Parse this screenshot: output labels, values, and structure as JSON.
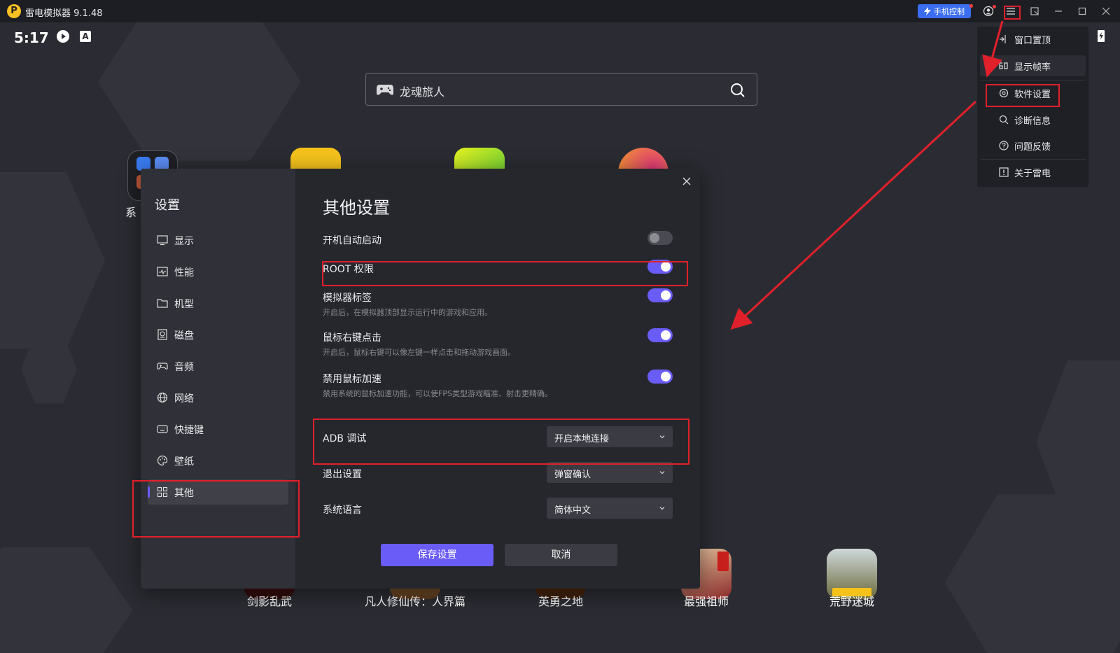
{
  "app": {
    "logo_letter": "P",
    "title": "雷电模拟器 9.1.48"
  },
  "titlebar": {
    "phone_control": "手机控制"
  },
  "status": {
    "time": "5:17",
    "ime": "A"
  },
  "search": {
    "placeholder": "龙魂旅人"
  },
  "desktop_icons": [
    {
      "label": "系"
    },
    {
      "label": "剑影乱武"
    },
    {
      "label": "凡人修仙传：人界篇"
    },
    {
      "label": "英勇之地"
    },
    {
      "label": "最强祖师"
    },
    {
      "label": "荒野迷城"
    }
  ],
  "menu": {
    "items": [
      {
        "label": "窗口置顶",
        "icon": "pin-icon"
      },
      {
        "label": "显示帧率",
        "icon": "fps-icon"
      },
      {
        "label": "软件设置",
        "icon": "gear-icon"
      },
      {
        "label": "诊断信息",
        "icon": "search-icon"
      },
      {
        "label": "问题反馈",
        "icon": "help-icon"
      },
      {
        "label": "关于雷电",
        "icon": "info-icon"
      }
    ]
  },
  "settings": {
    "side_title": "设置",
    "nav": [
      {
        "label": "显示",
        "icon": "monitor-icon"
      },
      {
        "label": "性能",
        "icon": "pulse-icon"
      },
      {
        "label": "机型",
        "icon": "folder-icon"
      },
      {
        "label": "磁盘",
        "icon": "disk-icon"
      },
      {
        "label": "音频",
        "icon": "gamepad-icon"
      },
      {
        "label": "网络",
        "icon": "globe-icon"
      },
      {
        "label": "快捷键",
        "icon": "keyboard-icon"
      },
      {
        "label": "壁纸",
        "icon": "palette-icon"
      },
      {
        "label": "其他",
        "icon": "grid-icon",
        "active": true
      }
    ],
    "title": "其他设置",
    "toggles": [
      {
        "label": "开机自动启动",
        "desc": "",
        "on": false
      },
      {
        "label": "ROOT 权限",
        "desc": "",
        "on": true
      },
      {
        "label": "模拟器标签",
        "desc": "开启后，在模拟器顶部显示运行中的游戏和应用。",
        "on": true
      },
      {
        "label": "鼠标右键点击",
        "desc": "开启后，鼠标右键可以像左键一样点击和拖动游戏画面。",
        "on": true
      },
      {
        "label": "禁用鼠标加速",
        "desc": "禁用系统的鼠标加速功能，可以使FPS类型游戏瞄准、射击更精确。",
        "on": true
      }
    ],
    "selects": [
      {
        "label": "ADB 调试",
        "value": "开启本地连接"
      },
      {
        "label": "退出设置",
        "value": "弹窗确认"
      },
      {
        "label": "系统语言",
        "value": "简体中文"
      }
    ],
    "save_label": "保存设置",
    "cancel_label": "取消"
  },
  "colors": {
    "accent": "#6a5cf7",
    "highlight": "#e0202a",
    "phone_btn": "#3a6df0"
  }
}
